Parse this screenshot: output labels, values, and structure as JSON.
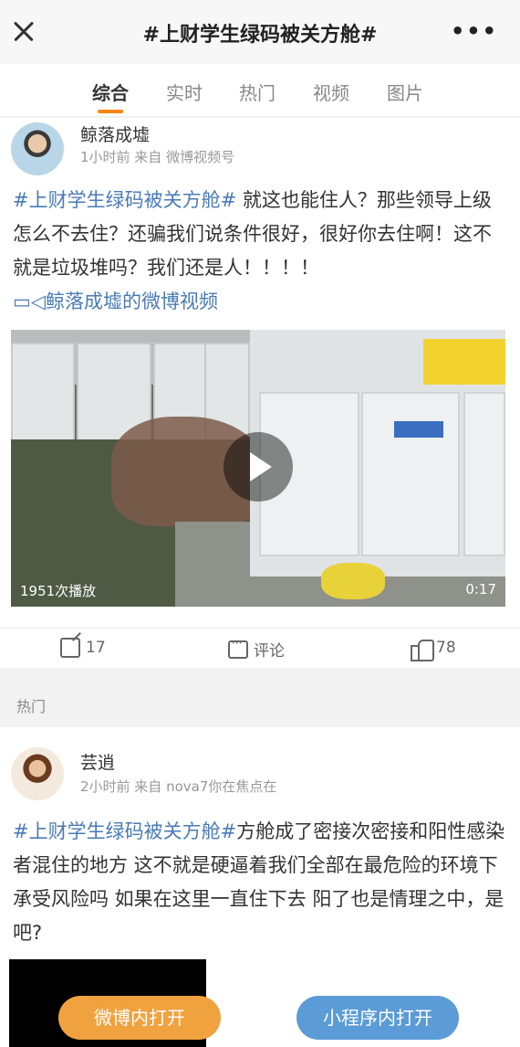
{
  "header": {
    "title": "#上财学生绿码被关方舱#"
  },
  "tabs": [
    {
      "label": "综合",
      "active": true
    },
    {
      "label": "实时",
      "active": false
    },
    {
      "label": "热门",
      "active": false
    },
    {
      "label": "视频",
      "active": false
    },
    {
      "label": "图片",
      "active": false
    }
  ],
  "post1": {
    "username": "鲸落成墟",
    "meta": "1小时前 来自 微博视频号",
    "topic": "#上财学生绿码被关方舱#",
    "text": " 就这也能住人？那些领导上级怎么不去住？还骗我们说条件很好，很好你去住啊！这不就是垃圾堆吗？我们还是人！！！！",
    "video_link": "鲸落成墟的微博视频",
    "video": {
      "play_count": "1951次播放",
      "duration": "0:17"
    },
    "actions": {
      "share": "17",
      "comment": "评论",
      "like": "78"
    }
  },
  "section_label": "热门",
  "post2": {
    "username": "芸逍",
    "meta": "2小时前 来自 nova7你在焦点在",
    "topic": "#上财学生绿码被关方舱#",
    "text": "方舱成了密接次密接和阳性感染者混住的地方 这不就是硬逼着我们全部在最危险的环境下承受风险吗 如果在这里一直住下去 阳了也是情理之中，是吧?"
  },
  "buttons": {
    "weibo": "微博内打开",
    "mini_program": "小程序内打开"
  }
}
